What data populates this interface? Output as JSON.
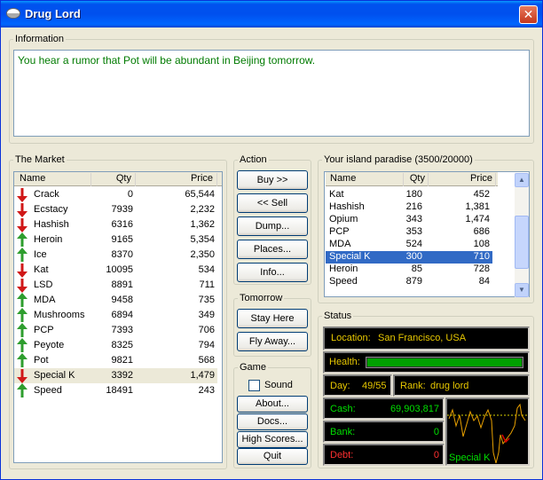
{
  "window": {
    "title": "Drug Lord",
    "close_label": "✕"
  },
  "info": {
    "legend": "Information",
    "message": "You hear a rumor that Pot will be abundant in Beijing tomorrow."
  },
  "market": {
    "legend": "The Market",
    "headers": [
      "Name",
      "Qty",
      "Price"
    ],
    "rows": [
      {
        "name": "Crack",
        "qty": "0",
        "price": "65,544",
        "trend": "down"
      },
      {
        "name": "Ecstacy",
        "qty": "7939",
        "price": "2,232",
        "trend": "down"
      },
      {
        "name": "Hashish",
        "qty": "6316",
        "price": "1,362",
        "trend": "down"
      },
      {
        "name": "Heroin",
        "qty": "9165",
        "price": "5,354",
        "trend": "up"
      },
      {
        "name": "Ice",
        "qty": "8370",
        "price": "2,350",
        "trend": "up"
      },
      {
        "name": "Kat",
        "qty": "10095",
        "price": "534",
        "trend": "down"
      },
      {
        "name": "LSD",
        "qty": "8891",
        "price": "711",
        "trend": "down"
      },
      {
        "name": "MDA",
        "qty": "9458",
        "price": "735",
        "trend": "up"
      },
      {
        "name": "Mushrooms",
        "qty": "6894",
        "price": "349",
        "trend": "up"
      },
      {
        "name": "PCP",
        "qty": "7393",
        "price": "706",
        "trend": "up"
      },
      {
        "name": "Peyote",
        "qty": "8325",
        "price": "794",
        "trend": "up"
      },
      {
        "name": "Pot",
        "qty": "9821",
        "price": "568",
        "trend": "up"
      },
      {
        "name": "Special K",
        "qty": "3392",
        "price": "1,479",
        "trend": "down",
        "selected": true
      },
      {
        "name": "Speed",
        "qty": "18491",
        "price": "243",
        "trend": "up"
      }
    ]
  },
  "action": {
    "legend": "Action",
    "buy": "Buy >>",
    "sell": "<< Sell",
    "dump": "Dump...",
    "places": "Places...",
    "info": "Info..."
  },
  "tomorrow": {
    "legend": "Tomorrow",
    "stay": "Stay Here",
    "fly": "Fly Away..."
  },
  "game": {
    "legend": "Game",
    "sound": "Sound",
    "about": "About...",
    "docs": "Docs...",
    "scores": "High Scores...",
    "quit": "Quit"
  },
  "island": {
    "legend": "Your island paradise (3500/20000)",
    "headers": [
      "Name",
      "Qty",
      "Price"
    ],
    "rows": [
      {
        "name": "Kat",
        "qty": "180",
        "price": "452"
      },
      {
        "name": "Hashish",
        "qty": "216",
        "price": "1,381"
      },
      {
        "name": "Opium",
        "qty": "343",
        "price": "1,474"
      },
      {
        "name": "PCP",
        "qty": "353",
        "price": "686"
      },
      {
        "name": "MDA",
        "qty": "524",
        "price": "108"
      },
      {
        "name": "Special K",
        "qty": "300",
        "price": "710",
        "selected": true
      },
      {
        "name": "Heroin",
        "qty": "85",
        "price": "728"
      },
      {
        "name": "Speed",
        "qty": "879",
        "price": "84"
      }
    ]
  },
  "status": {
    "legend": "Status",
    "location_label": "Location:",
    "location": "San Francisco, USA",
    "health_label": "Health:",
    "health_fraction": 1.0,
    "day_label": "Day:",
    "day": "49/55",
    "rank_label": "Rank:",
    "rank": "drug lord",
    "cash_label": "Cash:",
    "cash": "69,903,817",
    "bank_label": "Bank:",
    "bank": "0",
    "debt_label": "Debt:",
    "debt": "0",
    "graph_label": "Special K"
  },
  "colors": {
    "label_yellow": "#e8c800",
    "value_green": "#00e000",
    "debt_red": "#ff3030",
    "up": "#2e9e2e",
    "down": "#d01818"
  }
}
